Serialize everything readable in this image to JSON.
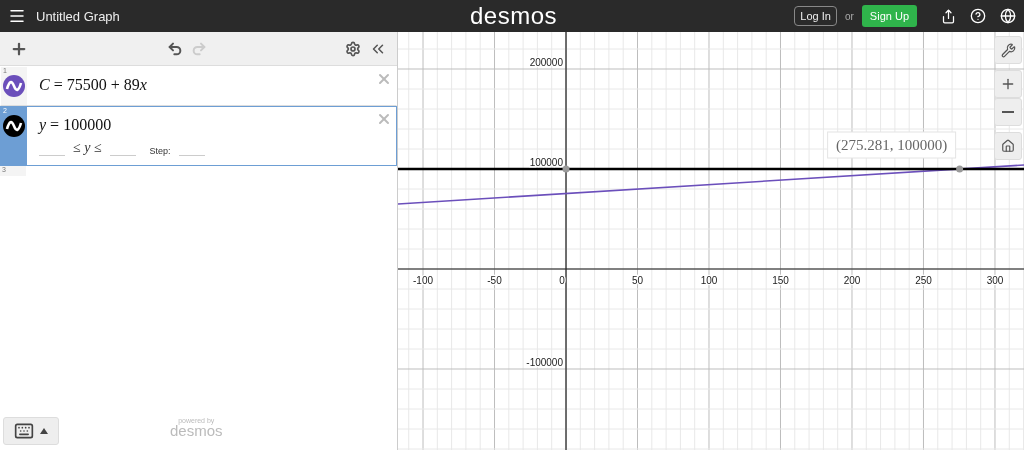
{
  "header": {
    "title": "Untitled Graph",
    "logo": "desmos",
    "login": "Log In",
    "or": "or",
    "signup": "Sign Up"
  },
  "expressions": [
    {
      "index": "1",
      "text": "C = 75500 + 89x",
      "color": "#6b4fbb",
      "selected": false
    },
    {
      "index": "2",
      "text": "y = 100000",
      "color": "#000000",
      "selected": true,
      "domain": {
        "middle": "≤ y ≤",
        "step": "Step:"
      }
    },
    {
      "index": "3"
    }
  ],
  "footer": {
    "powered": "powered by",
    "brand": "desmos"
  },
  "graph": {
    "chart_data": {
      "type": "line",
      "x": [
        -117.5,
        320.3
      ],
      "series": [
        {
          "color": "#6b4fbb",
          "values": [
            65000,
            104000
          ]
        },
        {
          "color": "#000000",
          "values": [
            100000,
            100000
          ]
        }
      ],
      "xlim": [
        -117.5,
        320.3
      ],
      "ylim": [
        -181000,
        237000
      ],
      "xticks": [
        -100,
        -50,
        0,
        50,
        100,
        150,
        200,
        250,
        300
      ],
      "yticks": [
        -100000,
        100000,
        200000
      ],
      "grid": true,
      "annotations": [
        {
          "x": 275.281,
          "y": 100000,
          "text": "(275.281, 100000)"
        }
      ]
    }
  }
}
